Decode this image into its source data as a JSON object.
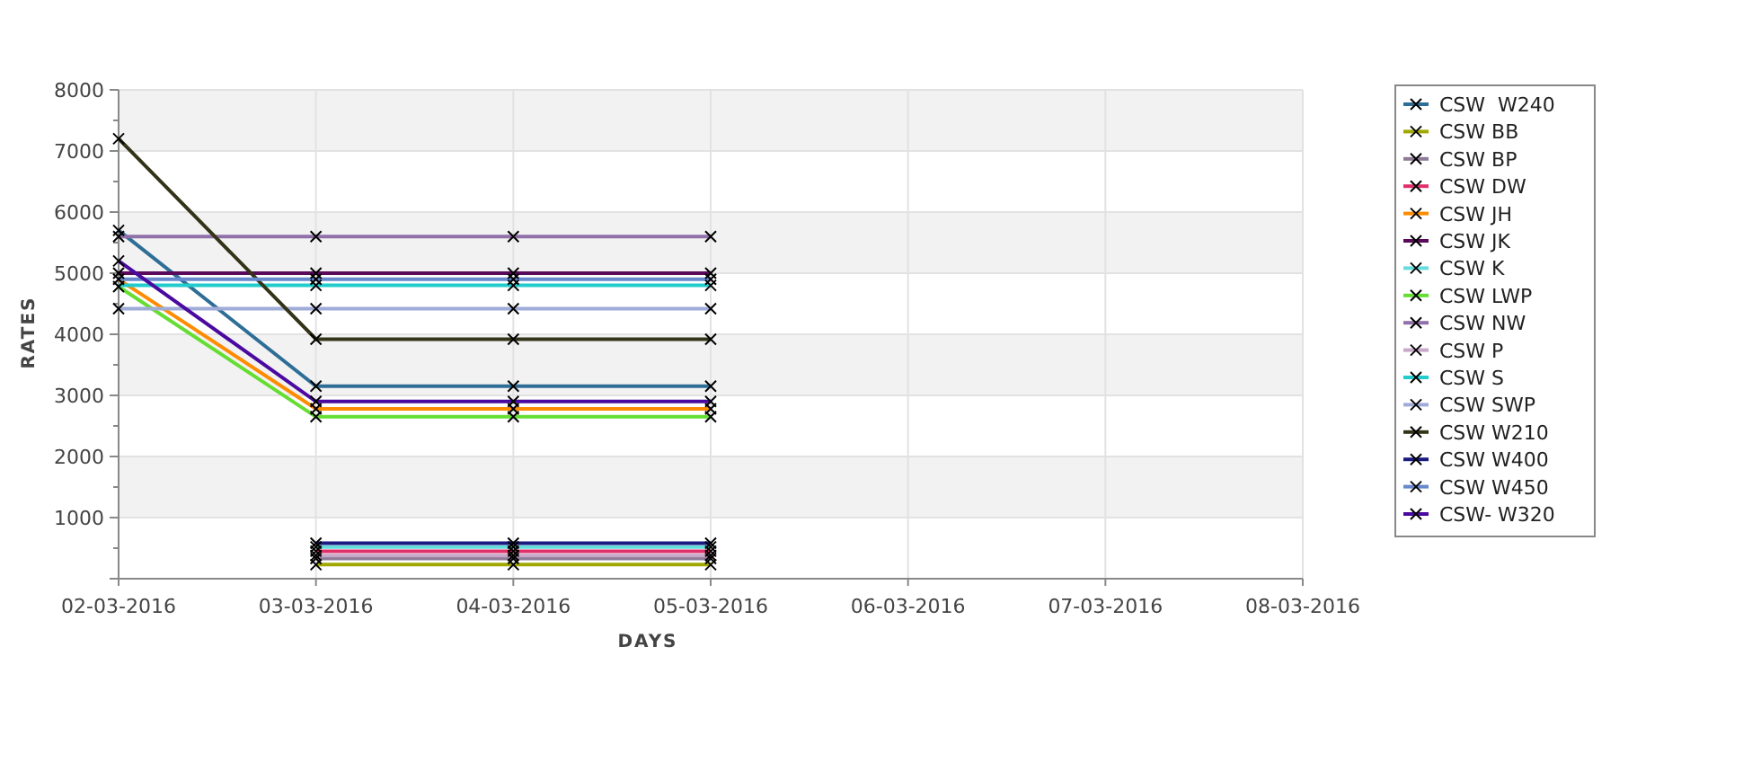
{
  "chart_data": {
    "type": "line",
    "xlabel": "DAYS",
    "ylabel": "RATES",
    "grid": true,
    "legend": true,
    "categories": [
      "02-03-2016",
      "03-03-2016",
      "04-03-2016",
      "05-03-2016",
      "06-03-2016",
      "07-03-2016",
      "08-03-2016"
    ],
    "ylim": [
      0,
      8000
    ],
    "yticks": [
      1000,
      2000,
      3000,
      4000,
      5000,
      6000,
      7000,
      8000
    ],
    "series": [
      {
        "name": "CSW  W240",
        "color": "#2e6e96",
        "marker": "x",
        "values": [
          5700,
          3150,
          3150,
          3150,
          null,
          null,
          null
        ]
      },
      {
        "name": "CSW BB",
        "color": "#a0a800",
        "marker": "x",
        "values": [
          null,
          230,
          230,
          230,
          null,
          null,
          null
        ]
      },
      {
        "name": "CSW BP",
        "color": "#8c7a96",
        "marker": "x",
        "values": [
          null,
          330,
          330,
          330,
          null,
          null,
          null
        ]
      },
      {
        "name": "CSW DW",
        "color": "#e0306a",
        "marker": "x",
        "values": [
          null,
          450,
          450,
          450,
          null,
          null,
          null
        ]
      },
      {
        "name": "CSW JH",
        "color": "#ff8c00",
        "marker": "x",
        "values": [
          4900,
          2780,
          2780,
          2780,
          null,
          null,
          null
        ]
      },
      {
        "name": "CSW JK",
        "color": "#5a0a5a",
        "marker": "x",
        "values": [
          5000,
          5000,
          5000,
          5000,
          null,
          null,
          null
        ]
      },
      {
        "name": "CSW K",
        "color": "#66dddd",
        "marker": "x",
        "values": [
          null,
          520,
          520,
          520,
          null,
          null,
          null
        ]
      },
      {
        "name": "CSW LWP",
        "color": "#66dd33",
        "marker": "x",
        "values": [
          4780,
          2650,
          2650,
          2650,
          null,
          null,
          null
        ]
      },
      {
        "name": "CSW NW",
        "color": "#9070a8",
        "marker": "x",
        "values": [
          5600,
          5600,
          5600,
          5600,
          null,
          null,
          null
        ]
      },
      {
        "name": "CSW P",
        "color": "#c8a8c8",
        "marker": "x",
        "values": [
          null,
          380,
          380,
          380,
          null,
          null,
          null
        ]
      },
      {
        "name": "CSW S",
        "color": "#22cccc",
        "marker": "x",
        "values": [
          4800,
          4800,
          4800,
          4800,
          null,
          null,
          null
        ]
      },
      {
        "name": "CSW SWP",
        "color": "#a0acd8",
        "marker": "x",
        "values": [
          4420,
          4420,
          4420,
          4420,
          null,
          null,
          null
        ]
      },
      {
        "name": "CSW W210",
        "color": "#333318",
        "marker": "x",
        "values": [
          7200,
          3920,
          3920,
          3920,
          null,
          null,
          null
        ]
      },
      {
        "name": "CSW W400",
        "color": "#1a1a80",
        "marker": "x",
        "values": [
          null,
          580,
          580,
          580,
          null,
          null,
          null
        ]
      },
      {
        "name": "CSW W450",
        "color": "#6688cc",
        "marker": "x",
        "values": [
          4900,
          4900,
          4900,
          4900,
          null,
          null,
          null
        ]
      },
      {
        "name": "CSW- W320",
        "color": "#4a0aa0",
        "marker": "x",
        "values": [
          5200,
          2900,
          2900,
          2900,
          null,
          null,
          null
        ]
      }
    ]
  }
}
